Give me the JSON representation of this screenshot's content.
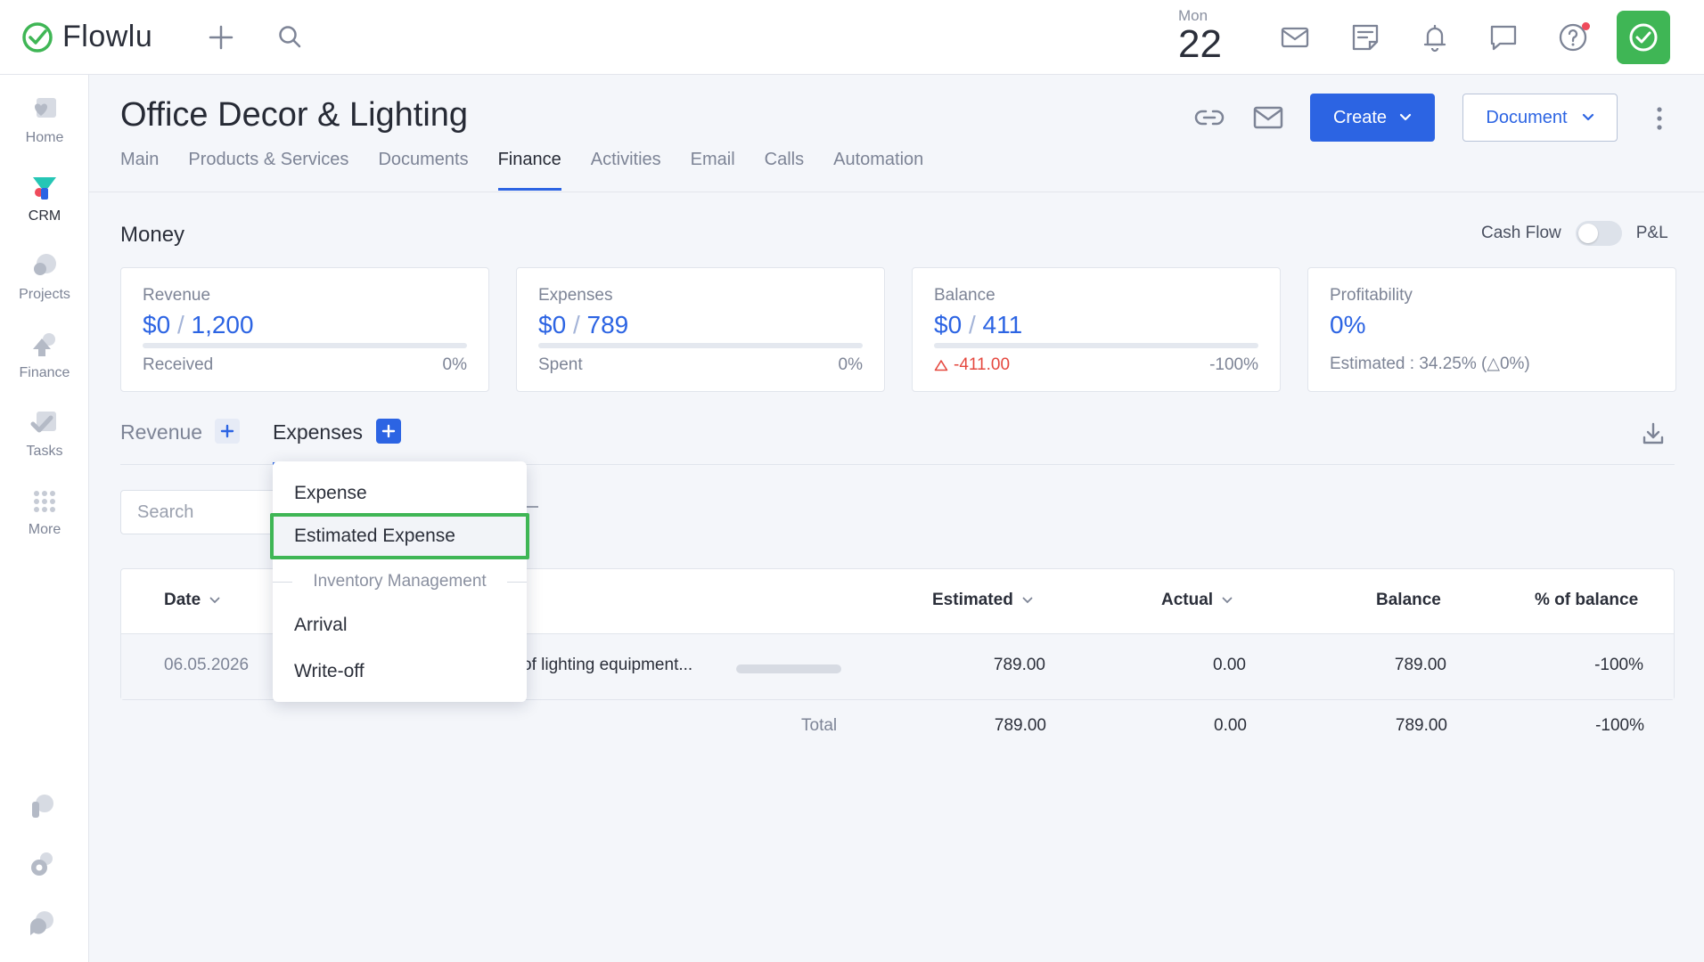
{
  "app": {
    "name": "Flowlu"
  },
  "topbar": {
    "day_of_week": "Mon",
    "day_number": "22"
  },
  "sidebar": {
    "items": [
      {
        "label": "Home"
      },
      {
        "label": "CRM"
      },
      {
        "label": "Projects"
      },
      {
        "label": "Finance"
      },
      {
        "label": "Tasks"
      },
      {
        "label": "More"
      }
    ]
  },
  "page": {
    "title": "Office Decor & Lighting",
    "tabs": [
      "Main",
      "Products & Services",
      "Documents",
      "Finance",
      "Activities",
      "Email",
      "Calls",
      "Automation"
    ],
    "active_tab": "Finance",
    "create_label": "Create",
    "document_label": "Document"
  },
  "money": {
    "title": "Money",
    "toggle_left": "Cash Flow",
    "toggle_right": "P&L",
    "cards": [
      {
        "label": "Revenue",
        "value_a": "$0",
        "value_b": "1,200",
        "sub": "Received",
        "pct": "0%",
        "progress": 0
      },
      {
        "label": "Expenses",
        "value_a": "$0",
        "value_b": "789",
        "sub": "Spent",
        "pct": "0%",
        "progress": 0
      },
      {
        "label": "Balance",
        "value_a": "$0",
        "value_b": "411",
        "sub": "-411.00",
        "pct": "-100%",
        "progress": 0
      },
      {
        "label": "Profitability",
        "value": "0%",
        "sub": "Estimated : 34.25% (△0%)"
      }
    ]
  },
  "subtabs": {
    "revenue": "Revenue",
    "expenses": "Expenses"
  },
  "search": {
    "placeholder": "Search"
  },
  "table": {
    "headers": [
      "Date",
      "Estimated",
      "Actual",
      "Balance",
      "% of balance"
    ],
    "rows": [
      {
        "date": "06.05.2026",
        "description": "of lighting equipment...",
        "estimated": "789.00",
        "actual": "0.00",
        "balance": "789.00",
        "pct": "-100%"
      }
    ],
    "total": {
      "label": "Total",
      "estimated": "789.00",
      "actual": "0.00",
      "balance": "789.00",
      "pct": "-100%"
    }
  },
  "dropdown": {
    "items": [
      "Expense",
      "Estimated Expense"
    ],
    "group_label": "Inventory Management",
    "group_items": [
      "Arrival",
      "Write-off"
    ],
    "highlighted": "Estimated Expense"
  },
  "colors": {
    "accent": "#2c64e3",
    "brand_green": "#3fb655",
    "negative": "#e5483f"
  }
}
